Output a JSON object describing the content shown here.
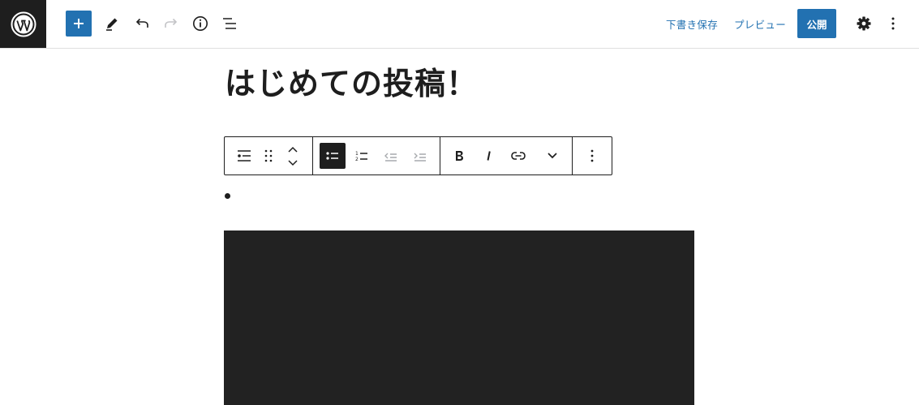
{
  "header": {
    "save_draft_label": "下書き保存",
    "preview_label": "プレビュー",
    "publish_label": "公開",
    "icons": {
      "logo": "wordpress-logo",
      "add": "plus-icon",
      "tools": "pencil-icon",
      "undo": "undo-icon",
      "redo": "redo-icon",
      "details": "info-icon",
      "outline": "list-view-icon",
      "settings": "gear-icon",
      "options": "more-vertical-icon"
    }
  },
  "editor": {
    "title": "はじめての投稿！"
  },
  "block_toolbar": {
    "icons": [
      "list-block-icon",
      "drag-handle-icon",
      "move-up-icon",
      "move-down-icon",
      "unordered-list-icon",
      "ordered-list-icon",
      "outdent-icon",
      "indent-icon",
      "bold-icon",
      "italic-icon",
      "link-icon",
      "chevron-down-icon",
      "more-vertical-icon"
    ]
  },
  "colors": {
    "accent": "#2271b1",
    "dark": "#1e1e1e",
    "media_background": "#222222"
  }
}
